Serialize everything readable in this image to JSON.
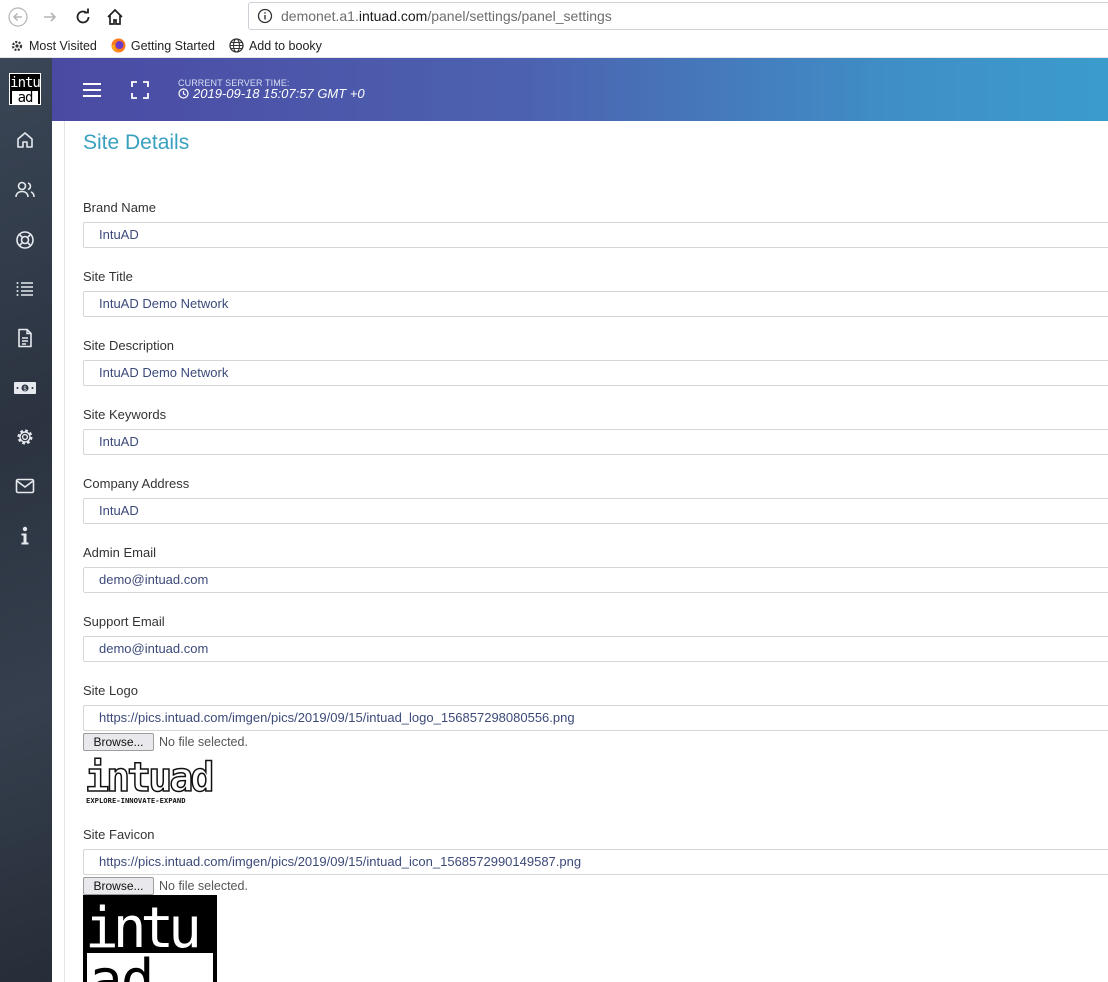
{
  "browser": {
    "url_prefix": "demonet.a1.",
    "url_host": "intuad.com",
    "url_path": "/panel/settings/panel_settings",
    "bookmarks": [
      "Most Visited",
      "Getting Started",
      "Add to booky"
    ]
  },
  "sidebar": {
    "logo_top": "intu",
    "logo_bottom": "ad",
    "items": [
      "home-icon",
      "users-icon",
      "lifebuoy-icon",
      "list-icon",
      "document-icon",
      "money-icon",
      "gear-icon",
      "mail-icon",
      "info-icon"
    ]
  },
  "header": {
    "server_time_label": "CURRENT SERVER TIME:",
    "server_time": "2019-09-18 15:07:57 GMT +0"
  },
  "page": {
    "title": "Site Details",
    "fields": [
      {
        "label": "Brand Name",
        "value": "IntuAD"
      },
      {
        "label": "Site Title",
        "value": "IntuAD Demo Network"
      },
      {
        "label": "Site Description",
        "value": "IntuAD Demo Network"
      },
      {
        "label": "Site Keywords",
        "value": "IntuAD"
      },
      {
        "label": "Company Address",
        "value": "IntuAD"
      },
      {
        "label": "Admin Email",
        "value": "demo@intuad.com"
      },
      {
        "label": "Support Email",
        "value": "demo@intuad.com"
      },
      {
        "label": "Site Logo",
        "value": "https://pics.intuad.com/imgen/pics/2019/09/15/intuad_logo_156857298080556.png"
      },
      {
        "label": "Site Favicon",
        "value": "https://pics.intuad.com/imgen/pics/2019/09/15/intuad_icon_1568572990149587.png"
      }
    ],
    "browse_label": "Browse...",
    "no_file_text": "No file selected.",
    "logo_text": "intuad",
    "logo_tagline": "EXPLORE-INNOVATE-EXPAND",
    "favicon_top": "intu",
    "favicon_bottom": "ad"
  },
  "colors": {
    "accent": "#3aa0bf",
    "header_start": "#4b4aa3",
    "header_end": "#3b9ccc",
    "sidebar": "#2b3340"
  }
}
